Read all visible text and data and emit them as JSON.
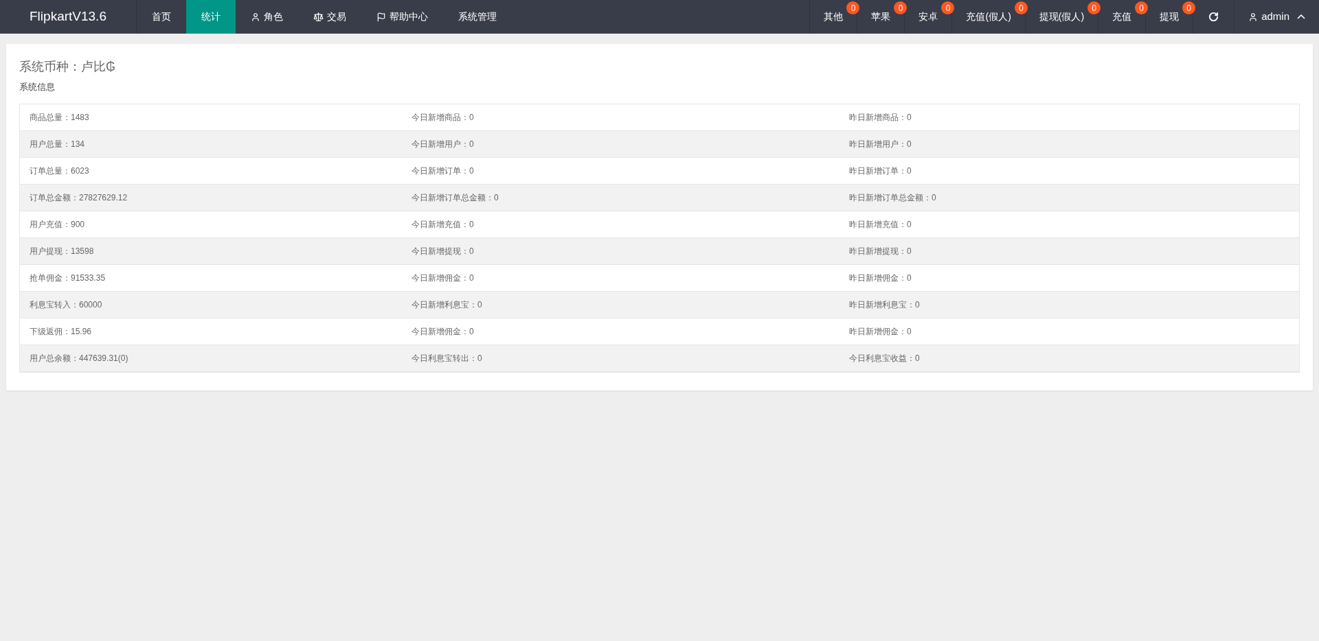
{
  "header": {
    "logo": "FlipkartV13.6",
    "nav": [
      {
        "label": "首页",
        "kind": "plain",
        "selected": false
      },
      {
        "label": "统计",
        "kind": "plain",
        "selected": true
      },
      {
        "label": "角色",
        "kind": "user",
        "selected": false
      },
      {
        "label": "交易",
        "kind": "scale",
        "selected": false
      },
      {
        "label": "帮助中心",
        "kind": "flag",
        "selected": false
      },
      {
        "label": "系统管理",
        "kind": "plain",
        "selected": false
      }
    ],
    "notices": [
      {
        "label": "其他",
        "count": "0"
      },
      {
        "label": "苹果",
        "count": "0"
      },
      {
        "label": "安卓",
        "count": "0"
      },
      {
        "label": "充值(假人)",
        "count": "0"
      },
      {
        "label": "提现(假人)",
        "count": "0"
      },
      {
        "label": "充值",
        "count": "0"
      },
      {
        "label": "提现",
        "count": "0"
      }
    ],
    "user": "admin"
  },
  "card": {
    "title": "系统币种：卢比₲",
    "subtitle": "系统信息",
    "rows": [
      [
        "商品总量：1483",
        "今日新增商品：0",
        "昨日新增商品：0"
      ],
      [
        "用户总量：134",
        "今日新增用户：0",
        "昨日新增用户：0"
      ],
      [
        "订单总量：6023",
        "今日新增订单：0",
        "昨日新增订单：0"
      ],
      [
        "订单总金额：27827629.12",
        "今日新增订单总金额：0",
        "昨日新增订单总金额：0"
      ],
      [
        "用户充值：900",
        "今日新增充值：0",
        "昨日新增充值：0"
      ],
      [
        "用户提现：13598",
        "今日新增提现：0",
        "昨日新增提现：0"
      ],
      [
        "抢单佣金：91533.35",
        "今日新增佣金：0",
        "昨日新增佣金：0"
      ],
      [
        "利息宝转入：60000",
        "今日新增利息宝：0",
        "昨日新增利息宝：0"
      ],
      [
        "下级返佣：15.96",
        "今日新增佣金：0",
        "昨日新增佣金：0"
      ],
      [
        "用户总余额：447639.31(0)",
        "今日利息宝转出：0",
        "今日利息宝收益：0"
      ]
    ]
  }
}
